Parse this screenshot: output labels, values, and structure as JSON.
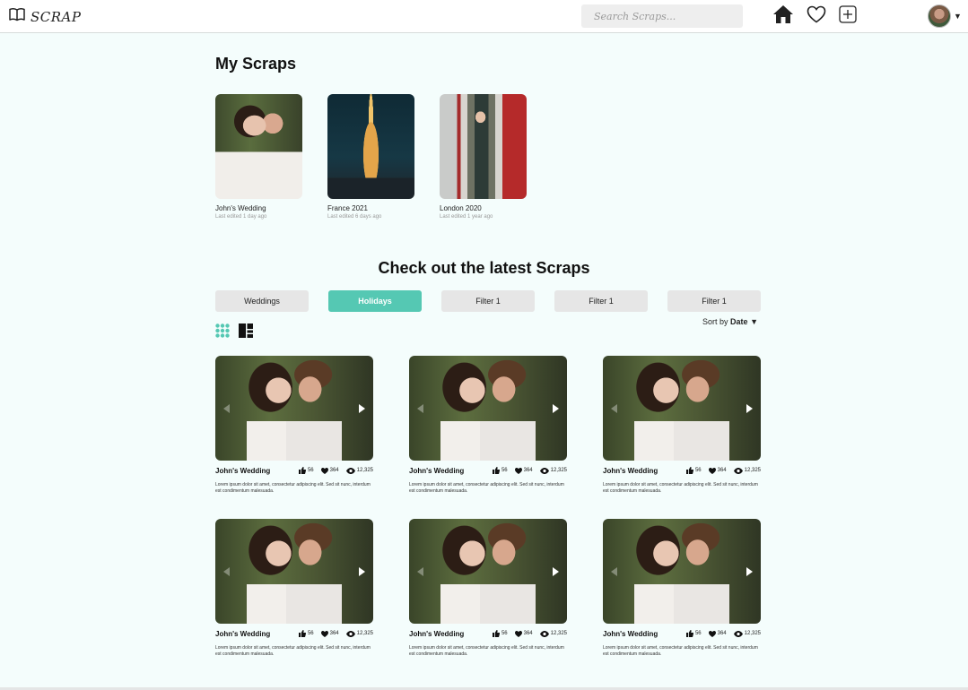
{
  "header": {
    "logo_text": "SCRAP",
    "search_placeholder": "Search Scraps...",
    "icons": [
      "book-icon",
      "home-icon",
      "heart-icon",
      "add-icon",
      "avatar",
      "chevron-down-icon"
    ]
  },
  "my_scraps": {
    "heading": "My Scraps",
    "items": [
      {
        "title": "John's Wedding",
        "subtitle": "Last edited 1 day ago"
      },
      {
        "title": "France 2021",
        "subtitle": "Last edited 6 days ago"
      },
      {
        "title": "London 2020",
        "subtitle": "Last edited 1 year ago"
      }
    ]
  },
  "latest": {
    "heading": "Check out the latest Scraps",
    "filters": [
      "Weddings",
      "Holidays",
      "Filter 1",
      "Filter 1",
      "Filter 1"
    ],
    "active_filter": "Holidays",
    "sort_prefix": "Sort by",
    "sort_value": "Date",
    "sort_caret": "▼",
    "accent_color": "#55c8b3",
    "cards": [
      {
        "title": "John's Wedding",
        "likes": "56",
        "hearts": "364",
        "views": "12,325",
        "description": "Lorem ipsum dolor sit amet, consectetur adipiscing elit. Sed sit nunc, interdum est condimentum malesuada."
      },
      {
        "title": "John's Wedding",
        "likes": "56",
        "hearts": "364",
        "views": "12,325",
        "description": "Lorem ipsum dolor sit amet, consectetur adipiscing elit. Sed sit nunc, interdum est condimentum malesuada."
      },
      {
        "title": "John's Wedding",
        "likes": "56",
        "hearts": "364",
        "views": "12,325",
        "description": "Lorem ipsum dolor sit amet, consectetur adipiscing elit. Sed sit nunc, interdum est condimentum malesuada."
      },
      {
        "title": "John's Wedding",
        "likes": "56",
        "hearts": "364",
        "views": "12,325",
        "description": "Lorem ipsum dolor sit amet, consectetur adipiscing elit. Sed sit nunc, interdum est condimentum malesuada."
      },
      {
        "title": "John's Wedding",
        "likes": "56",
        "hearts": "364",
        "views": "12,325",
        "description": "Lorem ipsum dolor sit amet, consectetur adipiscing elit. Sed sit nunc, interdum est condimentum malesuada."
      },
      {
        "title": "John's Wedding",
        "likes": "56",
        "hearts": "364",
        "views": "12,325",
        "description": "Lorem ipsum dolor sit amet, consectetur adipiscing elit. Sed sit nunc, interdum est condimentum malesuada."
      }
    ]
  }
}
